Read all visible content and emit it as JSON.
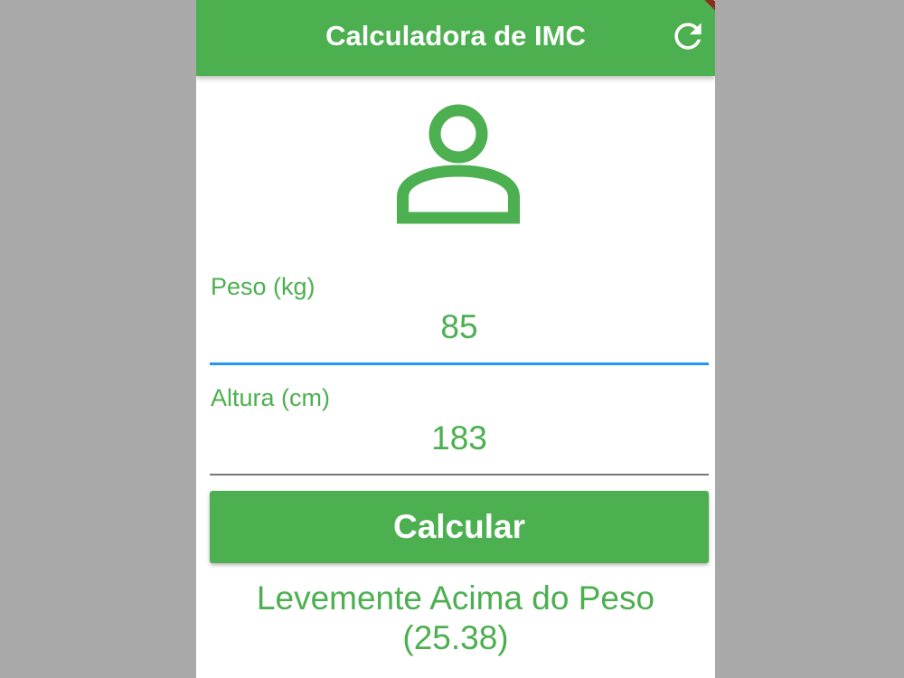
{
  "appbar": {
    "title": "Calculadora de IMC",
    "refresh_icon": "refresh-icon",
    "debug_banner": "DEBUG"
  },
  "avatar": {
    "icon": "person-outline-icon"
  },
  "weight": {
    "label": "Peso (kg)",
    "value": "85"
  },
  "height": {
    "label": "Altura (cm)",
    "value": "183"
  },
  "button": {
    "label": "Calcular"
  },
  "result": {
    "line1": "Levemente Acima do Peso",
    "line2": "(25.38)"
  },
  "colors": {
    "primary": "#4caf50",
    "focus_underline": "#2196f3",
    "background": "#ffffff",
    "outer_background": "#a9a9a9",
    "debug_banner": "#8b2e1f"
  }
}
